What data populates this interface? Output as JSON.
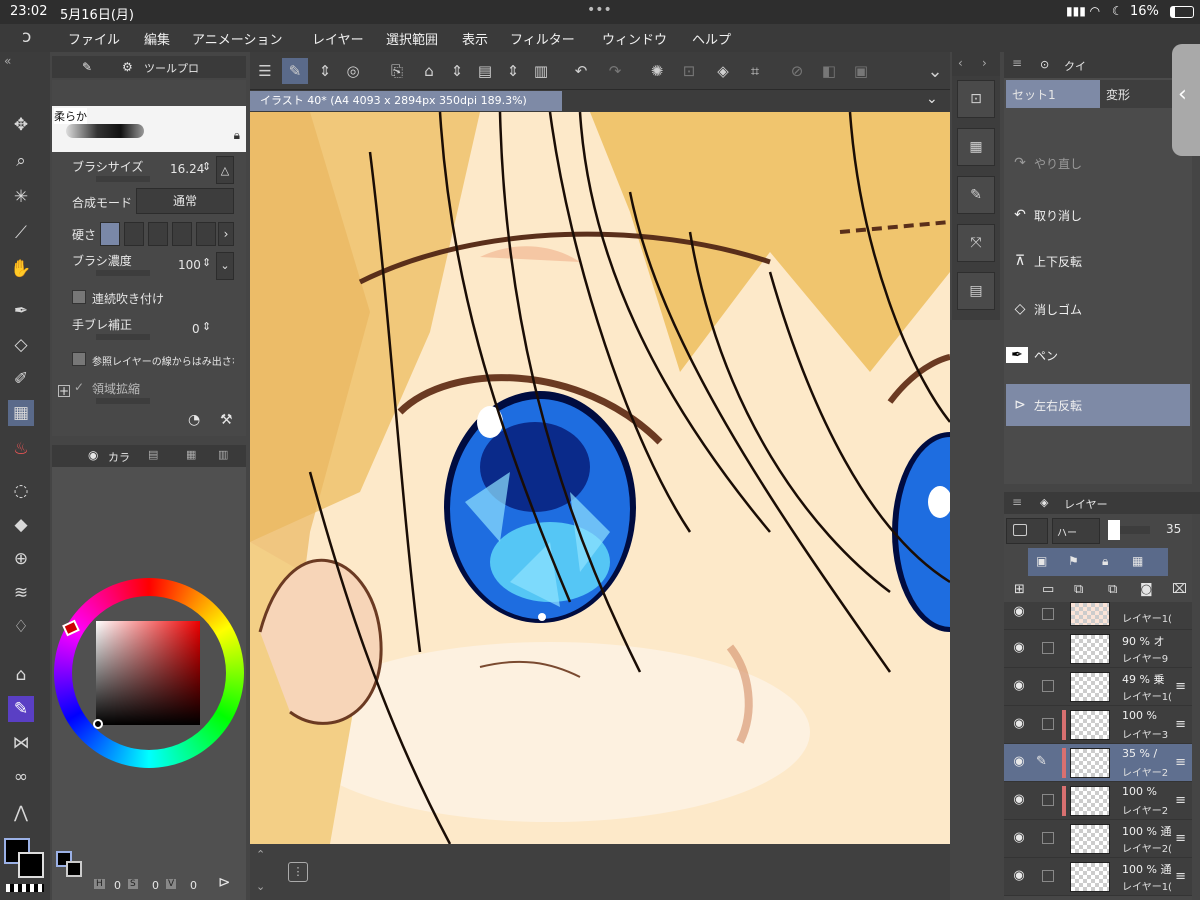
{
  "status": {
    "time": "23:02",
    "date": "5月16日(月)",
    "battery": "16%",
    "dots": "•••"
  },
  "menu": [
    "ファイル",
    "編集",
    "アニメーション",
    "レイヤー",
    "選択範囲",
    "表示",
    "フィルター",
    "ウィンドウ",
    "ヘルプ"
  ],
  "canvas_tab": {
    "title": "イラスト 40* (A4 4093 x 2894px 350dpi 189.3%)"
  },
  "tool_property": {
    "tab_label": "ツールプロ",
    "brush_name": "柔らか",
    "brush_size_label": "ブラシサイズ",
    "brush_size_value": "16.24",
    "blend_label": "合成モード",
    "blend_value": "通常",
    "hardness_label": "硬さ",
    "density_label": "ブラシ濃度",
    "density_value": "100",
    "airbrush_label": "連続吹き付け",
    "stabilizer_label": "手ブレ補正",
    "stabilizer_value": "0",
    "ref_layer_label": "参照レイヤーの線からはみ出さない",
    "area_label": "領域拡縮"
  },
  "color_panel": {
    "tab_label": "カラ",
    "hsv": {
      "h_label": "H",
      "h_value": "0",
      "s_label": "S",
      "s_value": "0",
      "v_label": "V",
      "v_value": "0"
    }
  },
  "quick_access": {
    "tab_label": "クイ",
    "set_label": "セット1",
    "transform_label": "変形",
    "items": [
      "やり直し",
      "取り消し",
      "上下反転",
      "消しゴム",
      "ペン",
      "左右反転"
    ]
  },
  "layers": {
    "tab_label": "レイヤー",
    "blend_short": "ハー",
    "opacity": "35",
    "rows": [
      {
        "pct": "",
        "name": "レイヤー1("
      },
      {
        "pct": "90 % オ",
        "name": "レイヤー9"
      },
      {
        "pct": "49 % 乗",
        "name": "レイヤー1("
      },
      {
        "pct": "100 %",
        "name": "レイヤー3"
      },
      {
        "pct": "35 % /",
        "name": "レイヤー2"
      },
      {
        "pct": "100 %",
        "name": "レイヤー2"
      },
      {
        "pct": "100 % 通",
        "name": "レイヤー2("
      },
      {
        "pct": "100 % 通",
        "name": "レイヤー1("
      }
    ]
  },
  "colors": {
    "accent": "#6f7fa3",
    "canvas_bg": "#fde9c9",
    "panel_dark": "#3a3a3a"
  }
}
